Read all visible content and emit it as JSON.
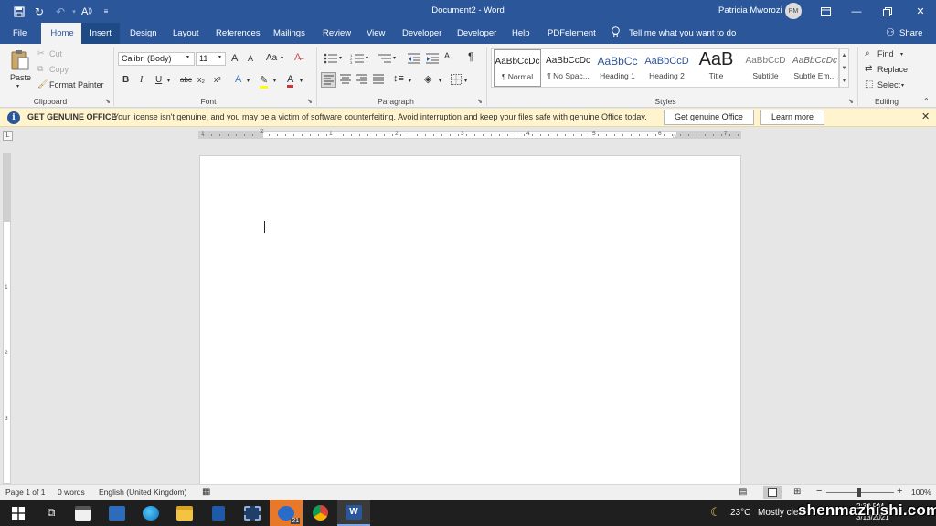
{
  "titlebar": {
    "title": "Document2  -  Word",
    "user": "Patricia Mworozi",
    "user_initials": "PM",
    "icons": [
      "save-icon",
      "autosave-icon",
      "undo-icon",
      "read-aloud-icon",
      "customize-icon"
    ]
  },
  "tabs": [
    "File",
    "Home",
    "Insert",
    "Design",
    "Layout",
    "References",
    "Mailings",
    "Review",
    "View",
    "Developer",
    "Developer",
    "Help",
    "PDFelement"
  ],
  "tellme": "Tell me what you want to do",
  "share": "Share",
  "clipboard": {
    "paste": "Paste",
    "cut": "Cut",
    "copy": "Copy",
    "format_painter": "Format Painter",
    "label": "Clipboard"
  },
  "font": {
    "name": "Calibri (Body)",
    "size": "11",
    "label": "Font",
    "b": "B",
    "i": "I",
    "u": "U",
    "abc": "abc",
    "sub": "x₂",
    "sup": "x²",
    "aa": "Aa",
    "grow": "A",
    "shrink": "A"
  },
  "paragraph": {
    "label": "Paragraph",
    "pilcrow": "¶"
  },
  "styles": {
    "label": "Styles",
    "items": [
      {
        "preview": "AaBbCcDc",
        "name": "¶ Normal"
      },
      {
        "preview": "AaBbCcDc",
        "name": "¶ No Spac..."
      },
      {
        "preview": "AaBbCc",
        "name": "Heading 1"
      },
      {
        "preview": "AaBbCcD",
        "name": "Heading 2"
      },
      {
        "preview": "AaB",
        "name": "Title"
      },
      {
        "preview": "AaBbCcD",
        "name": "Subtitle"
      },
      {
        "preview": "AaBbCcDc",
        "name": "Subtle Em..."
      }
    ]
  },
  "editing": {
    "find": "Find",
    "replace": "Replace",
    "select": "Select",
    "label": "Editing"
  },
  "message": {
    "title": "GET GENUINE OFFICE",
    "text": "Your license isn't genuine, and you may be a victim of software counterfeiting. Avoid interruption and keep your files safe with genuine Office today.",
    "button1": "Get genuine Office",
    "button2": "Learn more"
  },
  "ruler": {
    "h_numbers": [
      "1",
      "1",
      "2",
      "3",
      "4",
      "5",
      "6",
      "7"
    ],
    "v_numbers": [
      "1",
      "2",
      "3"
    ],
    "corner": "L"
  },
  "status": {
    "page": "Page 1 of 1",
    "words": "0 words",
    "language": "English (United Kingdom)",
    "zoom": "100%",
    "zoom_minus": "−",
    "zoom_plus": "+"
  },
  "taskbar": {
    "weather_temp": "23°C",
    "weather_desc": "Mostly clea",
    "time": "2:30 PM",
    "date": "3/13/2021",
    "chrome_badge": "21",
    "watermark": "shenmazhishi.com"
  },
  "colors": {
    "word_blue": "#2b579a",
    "message_bg": "#fff4ce",
    "taskbar": "#1f1f1f"
  }
}
